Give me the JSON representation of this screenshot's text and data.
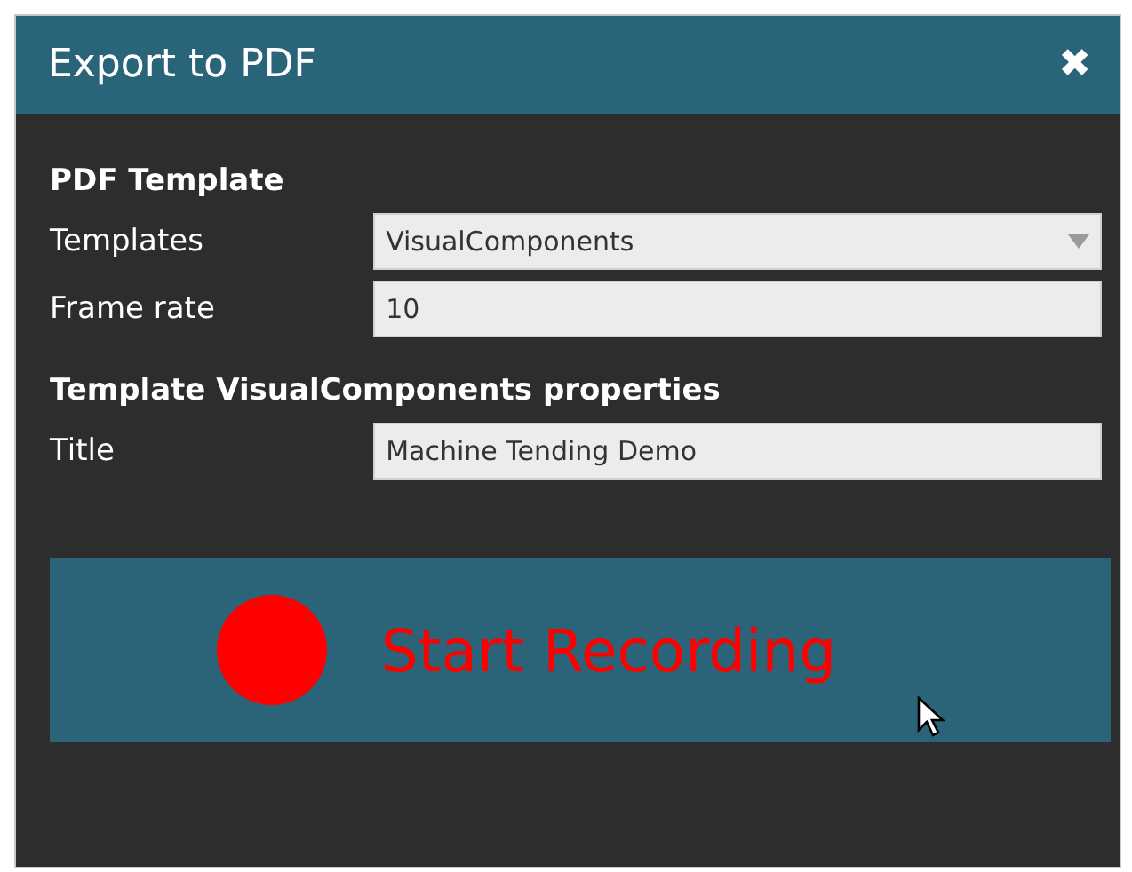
{
  "window": {
    "title": "Export to PDF",
    "close": "✖"
  },
  "sections": [
    {
      "heading": "PDF Template",
      "fields": [
        {
          "kind": "dropdown",
          "label": "Templates",
          "value": "VisualComponents"
        },
        {
          "kind": "text",
          "label": "Frame rate",
          "value": "10"
        }
      ]
    },
    {
      "heading": "Template VisualComponents properties",
      "fields": [
        {
          "kind": "text",
          "label": "Title",
          "value": "Machine Tending Demo"
        }
      ]
    }
  ],
  "record_button": {
    "label": "Start Recording"
  }
}
